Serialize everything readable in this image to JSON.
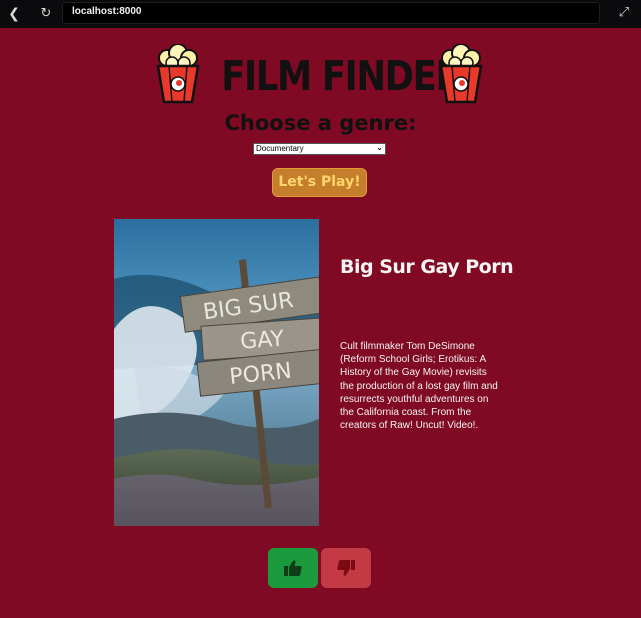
{
  "browser": {
    "url": "localhost:8000",
    "back_icon": "chevron-left-icon",
    "reload_icon": "reload-icon",
    "expand_icon": "expand-icon"
  },
  "header": {
    "app_title": "FILM FINDER",
    "logo_icon": "popcorn-icon"
  },
  "genre": {
    "heading": "Choose a genre:",
    "selected": "Documentary"
  },
  "play_button": {
    "label": "Let's Play!"
  },
  "movie": {
    "title": "Big Sur Gay Porn",
    "poster_sign_text": [
      "BIG SUR",
      "GAY",
      "PORN"
    ],
    "description": "Cult filmmaker Tom DeSimone (Reform School Girls; Erotikus: A History of the Gay Movie) revisits the production of a lost gay film and resurrects youthful adventures on the California coast. From the creators of Raw! Uncut! Video!."
  },
  "vote": {
    "like_icon": "thumbs-up-icon",
    "dislike_icon": "thumbs-down-icon"
  },
  "colors": {
    "background": "#800a24",
    "play_button": "#c47e2c",
    "like": "#1a9a3c",
    "dislike": "#c43a44"
  }
}
